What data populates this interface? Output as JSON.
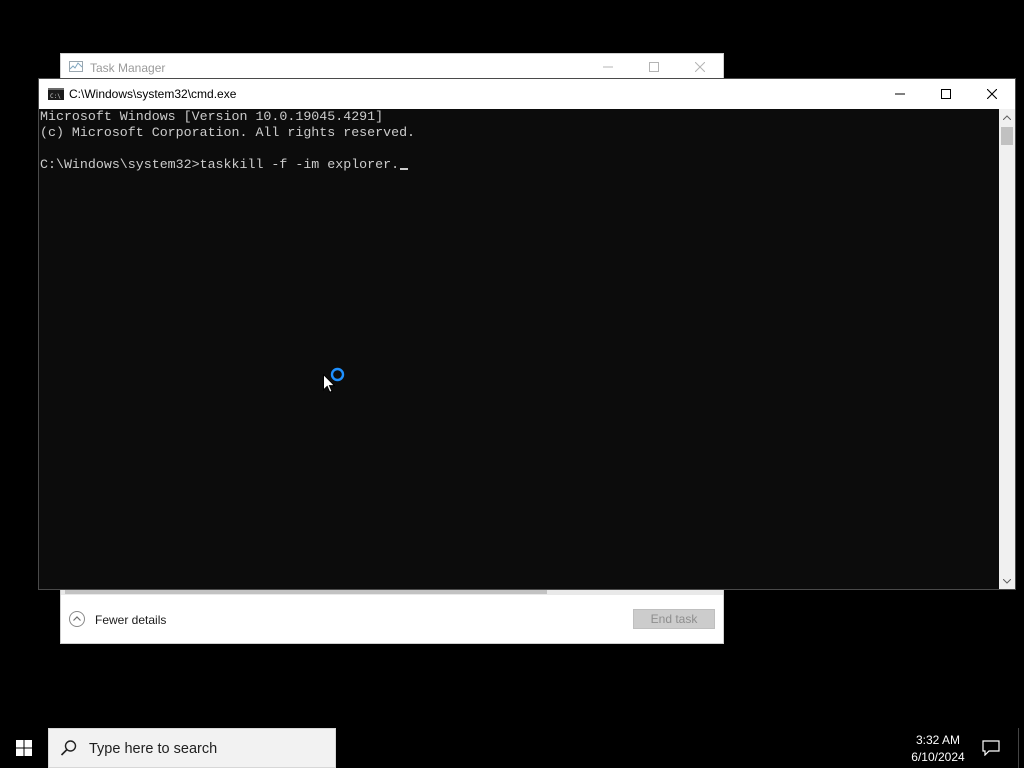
{
  "task_manager": {
    "title": "Task Manager",
    "fewer_details_label": "Fewer details",
    "end_task_label": "End task"
  },
  "cmd": {
    "title": "C:\\Windows\\system32\\cmd.exe",
    "lines": [
      "Microsoft Windows [Version 10.0.19045.4291]",
      "(c) Microsoft Corporation. All rights reserved.",
      "",
      "C:\\Windows\\system32>taskkill -f -im explorer."
    ]
  },
  "taskbar": {
    "search_placeholder": "Type here to search",
    "time": "3:32 AM",
    "date": "6/10/2024"
  },
  "colors": {
    "console_bg": "#0c0c0c",
    "console_text": "#cccccc",
    "busy_ring": "#1e90ff"
  }
}
